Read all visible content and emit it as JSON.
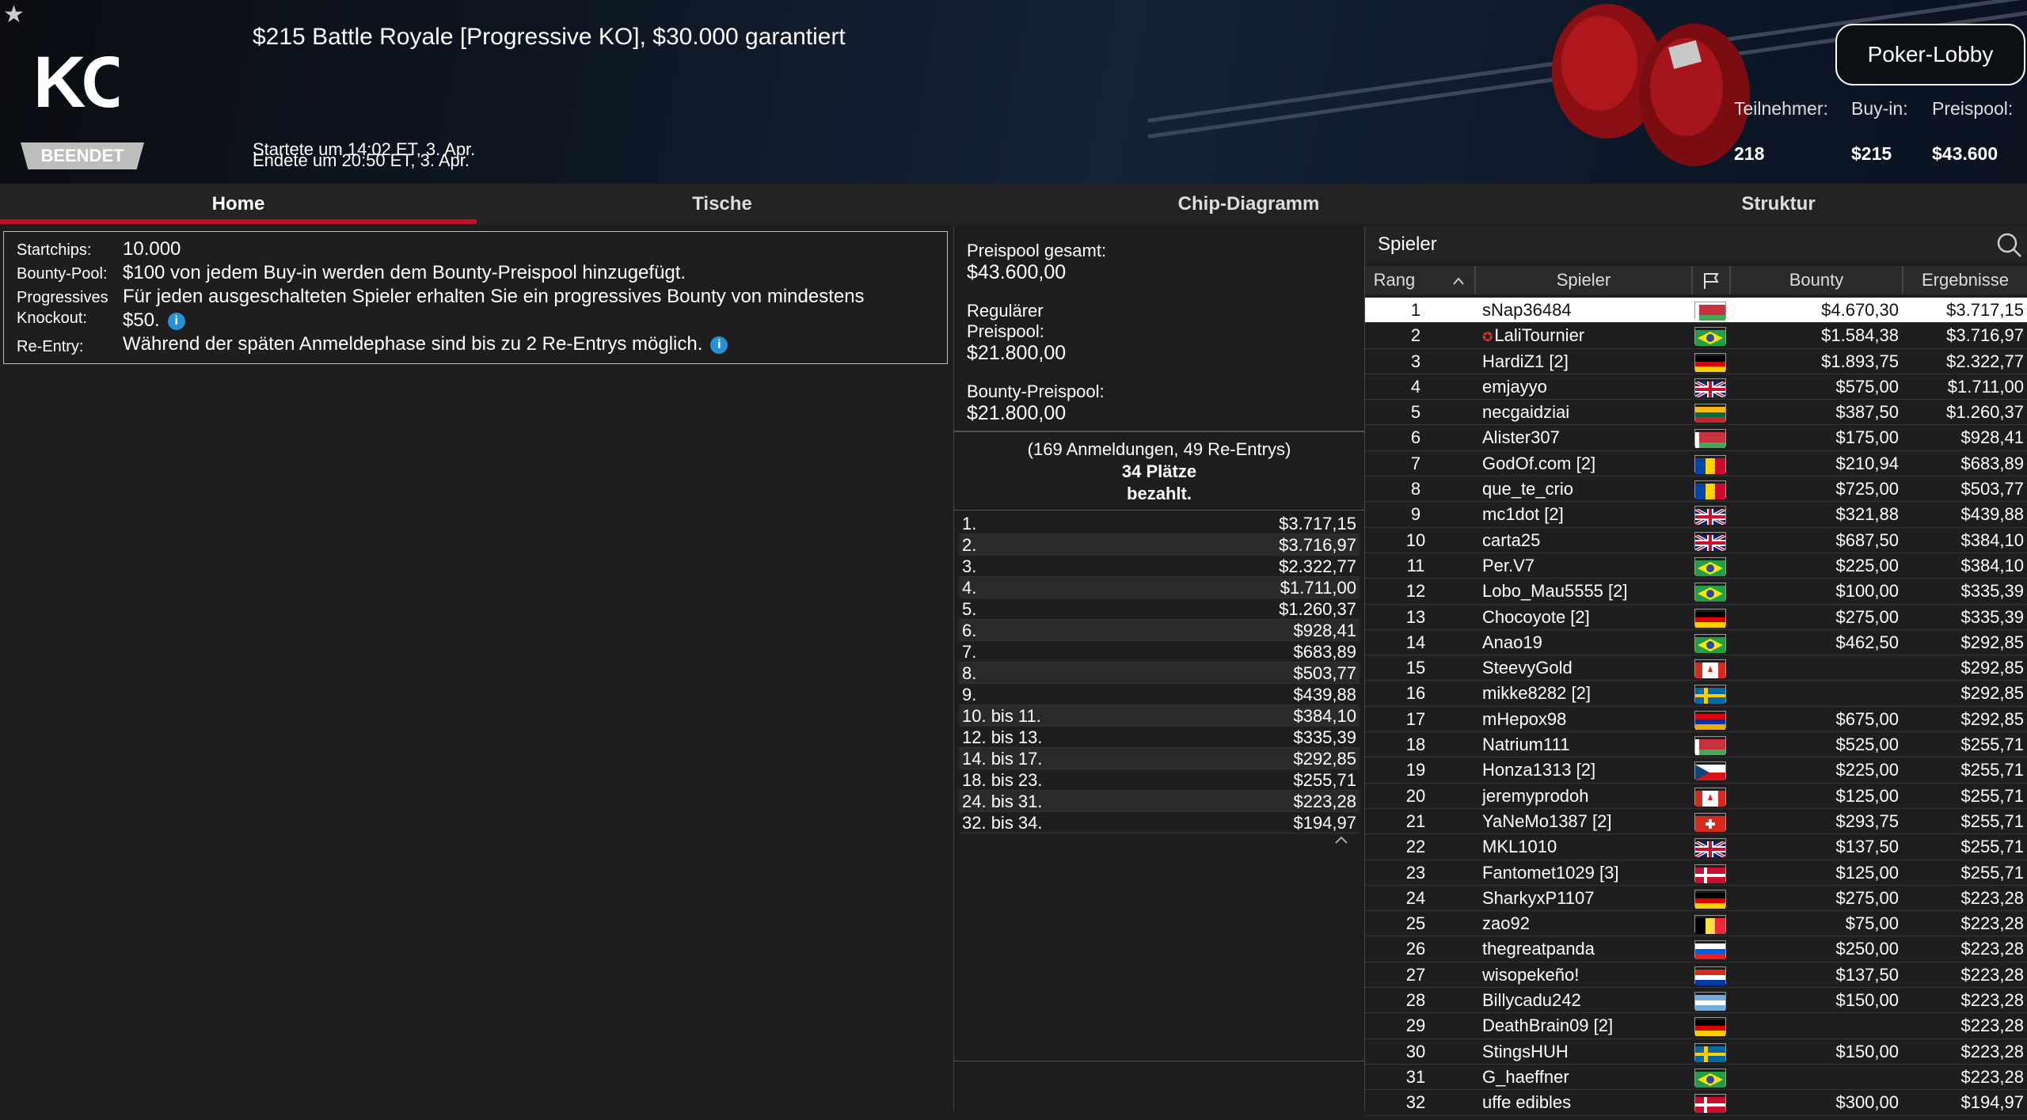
{
  "header": {
    "title": "$215 Battle Royale [Progressive KO], $30.000 garantiert",
    "started": "Startete um 14:02 ET, 3. Apr.",
    "ended": "Endete um 20:50 ET, 3. Apr.",
    "status": "BEENDET",
    "lobby_button": "Poker-Lobby",
    "stats": {
      "participants_label": "Teilnehmer:",
      "participants": "218",
      "buyin_label": "Buy-in:",
      "buyin": "$215",
      "prizepool_label": "Preispool:",
      "prizepool": "$43.600"
    }
  },
  "tabs": [
    "Home",
    "Tische",
    "Chip-Diagramm",
    "Struktur"
  ],
  "info": {
    "startchips_label": "Startchips:",
    "startchips": "10.000",
    "bountypool_label": "Bounty-Pool:",
    "bountypool": "$100 von jedem Buy-in werden dem Bounty-Preispool hinzugefügt.",
    "progressive_label1": "Progressives",
    "progressive_label2": "Knockout:",
    "progressive_line1": "Für jeden ausgeschalteten Spieler erhalten Sie ein progressives Bounty von mindestens",
    "progressive_line2": "$50.",
    "reentry_label": "Re-Entry:",
    "reentry": "Während der späten Anmeldephase sind bis zu 2 Re-Entrys möglich.",
    "info_icon": "i"
  },
  "prizepool": {
    "total_label": "Preispool gesamt:",
    "total": "$43.600,00",
    "regular_label1": "Regulärer",
    "regular_label2": "Preispool:",
    "regular": "$21.800,00",
    "bounty_label": "Bounty-Preispool:",
    "bounty": "$21.800,00",
    "entries": "(169 Anmeldungen, 49 Re-Entrys)",
    "paid1": "34 Plätze",
    "paid2": "bezahlt.",
    "payouts": [
      [
        "1.",
        "$3.717,15"
      ],
      [
        "2.",
        "$3.716,97"
      ],
      [
        "3.",
        "$2.322,77"
      ],
      [
        "4.",
        "$1.711,00"
      ],
      [
        "5.",
        "$1.260,37"
      ],
      [
        "6.",
        "$928,41"
      ],
      [
        "7.",
        "$683,89"
      ],
      [
        "8.",
        "$503,77"
      ],
      [
        "9.",
        "$439,88"
      ],
      [
        "10. bis 11.",
        "$384,10"
      ],
      [
        "12. bis 13.",
        "$335,39"
      ],
      [
        "14. bis 17.",
        "$292,85"
      ],
      [
        "18. bis 23.",
        "$255,71"
      ],
      [
        "24. bis 31.",
        "$223,28"
      ],
      [
        "32. bis 34.",
        "$194,97"
      ]
    ]
  },
  "players": {
    "title": "Spieler",
    "columns": {
      "rank": "Rang",
      "name": "Spieler",
      "bounty": "Bounty",
      "result": "Ergebnisse"
    },
    "rows": [
      [
        "1",
        "sNap36484",
        "by",
        "$4.670,30",
        "$3.717,15"
      ],
      [
        "2",
        "LaliTournier",
        "br",
        "$1.584,38",
        "$3.716,97"
      ],
      [
        "3",
        "HardiZ1 [2]",
        "de",
        "$1.893,75",
        "$2.322,77"
      ],
      [
        "4",
        "emjayyo",
        "gb",
        "$575,00",
        "$1.711,00"
      ],
      [
        "5",
        "necgaidziai",
        "lt",
        "$387,50",
        "$1.260,37"
      ],
      [
        "6",
        "Alister307",
        "by",
        "$175,00",
        "$928,41"
      ],
      [
        "7",
        "GodOf.com [2]",
        "md",
        "$210,94",
        "$683,89"
      ],
      [
        "8",
        "que_te_crio",
        "md",
        "$725,00",
        "$503,77"
      ],
      [
        "9",
        "mc1dot [2]",
        "gb",
        "$321,88",
        "$439,88"
      ],
      [
        "10",
        "carta25",
        "gb",
        "$687,50",
        "$384,10"
      ],
      [
        "11",
        "Per.V7",
        "br",
        "$225,00",
        "$384,10"
      ],
      [
        "12",
        "Lobo_Mau5555 [2]",
        "br",
        "$100,00",
        "$335,39"
      ],
      [
        "13",
        "Chocoyote [2]",
        "de",
        "$275,00",
        "$335,39"
      ],
      [
        "14",
        "Anao19",
        "br",
        "$462,50",
        "$292,85"
      ],
      [
        "15",
        "SteevyGold",
        "ca",
        "",
        "$292,85"
      ],
      [
        "16",
        "mikke8282 [2]",
        "se",
        "",
        "$292,85"
      ],
      [
        "17",
        "mHepox98",
        "am",
        "$675,00",
        "$292,85"
      ],
      [
        "18",
        "Natrium111",
        "by",
        "$525,00",
        "$255,71"
      ],
      [
        "19",
        "Honza1313 [2]",
        "cz",
        "$225,00",
        "$255,71"
      ],
      [
        "20",
        "jeremyprodoh",
        "ca",
        "$125,00",
        "$255,71"
      ],
      [
        "21",
        "YaNeMo1387 [2]",
        "ch",
        "$293,75",
        "$255,71"
      ],
      [
        "22",
        "MKL1010",
        "gb",
        "$137,50",
        "$255,71"
      ],
      [
        "23",
        "Fantomet1029 [3]",
        "dk",
        "$125,00",
        "$255,71"
      ],
      [
        "24",
        "SharkyxP1107",
        "de",
        "$275,00",
        "$223,28"
      ],
      [
        "25",
        "zao92",
        "be",
        "$75,00",
        "$223,28"
      ],
      [
        "26",
        "thegreatpanda",
        "si",
        "$250,00",
        "$223,28"
      ],
      [
        "27",
        "wisopekeño!",
        "py",
        "$137,50",
        "$223,28"
      ],
      [
        "28",
        "Billycadu242",
        "ar",
        "$150,00",
        "$223,28"
      ],
      [
        "29",
        "DeathBrain09 [2]",
        "de",
        "",
        "$223,28"
      ],
      [
        "30",
        "StingsHUH",
        "se",
        "$150,00",
        "$223,28"
      ],
      [
        "31",
        "G_haeffner",
        "br",
        "",
        "$223,28"
      ],
      [
        "32",
        "uffe edibles",
        "dk",
        "$300,00",
        "$194,97"
      ]
    ]
  },
  "colors": {
    "accent": "#c4102a",
    "info_icon": "#2b8fd4"
  }
}
